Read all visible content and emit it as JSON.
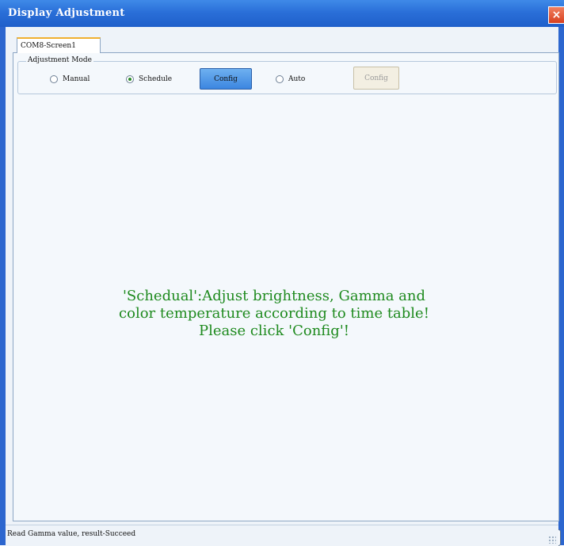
{
  "window": {
    "title": "Display Adjustment",
    "close_glyph": "×"
  },
  "tabs": [
    {
      "label": "COM8-Screen1",
      "selected": true
    }
  ],
  "adjustment_mode": {
    "group_title": "Adjustment Mode",
    "options": [
      {
        "label": "Manual",
        "checked": false
      },
      {
        "label": "Schedule",
        "checked": true
      },
      {
        "label": "Auto",
        "checked": false
      }
    ],
    "schedule_config_label": "Config",
    "auto_config_label": "Config"
  },
  "main": {
    "message": "'Schedual':Adjust brightness, Gamma and\ncolor temperature according to time table!\nPlease click 'Config'!"
  },
  "status": {
    "text": "Read Gamma value, result-Succeed"
  },
  "icons": {
    "close": "close-icon",
    "expand": "double-chevron-down-icon",
    "grip": "resize-grip-icon"
  },
  "colors": {
    "title_bar": "#2a6fd8",
    "message_text": "#1e8a1e",
    "active_button": "#3c86e0"
  }
}
